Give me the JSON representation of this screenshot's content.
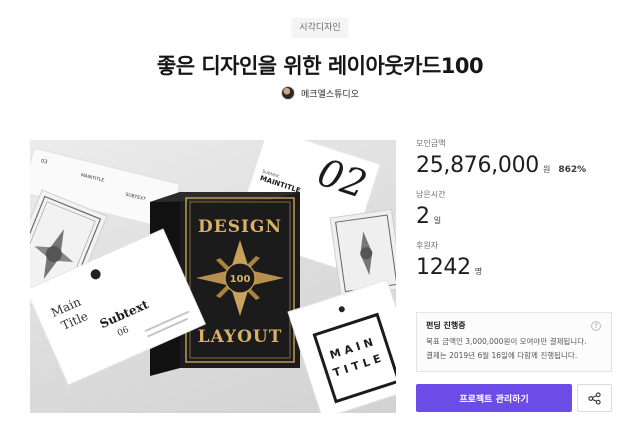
{
  "category": "시각디자인",
  "title": "좋은 디자인을 위한 레이아웃카드100",
  "creator": {
    "name": "메크엘스튜디오"
  },
  "hero": {
    "deck_text": {
      "line1": "DESIGN",
      "number": "100",
      "line2": "LAYOUT"
    },
    "cards": {
      "top_left": {
        "number": "03",
        "label1": "MAINTITLE",
        "label2": "SUBTEXT"
      },
      "top_right": {
        "number": "02",
        "label1": "Subtext",
        "label2": "MAINTITLE"
      },
      "bottom_left": {
        "line1": "Main",
        "line2": "Title",
        "line3": "Subtext",
        "line4": "06"
      },
      "bottom_right": {
        "line1": "MAIN",
        "line2": "TITLE"
      }
    }
  },
  "stats": {
    "amount_label": "모인금액",
    "amount_value": "25,876,000",
    "amount_unit": "원",
    "amount_rate": "862%",
    "time_label": "남은시간",
    "time_value": "2",
    "time_unit": "일",
    "backers_label": "후원자",
    "backers_value": "1242",
    "backers_unit": "명"
  },
  "funding": {
    "title": "펀딩 진행중",
    "line1": "목표 금액인 3,000,000원이 모여야만 결제됩니다.",
    "line2": "결제는 2019년 6월 16일에 다함께 진행됩니다."
  },
  "actions": {
    "manage_label": "프로젝트 관리하기"
  },
  "colors": {
    "accent": "#6b4ce6",
    "deck": "#1b1b1b",
    "gold": "#c9a25a"
  }
}
